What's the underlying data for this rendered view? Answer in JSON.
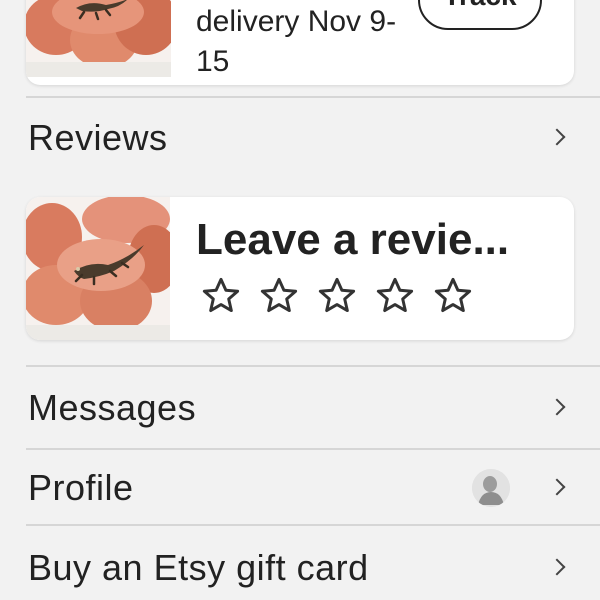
{
  "order_card": {
    "delivery_text": "delivery Nov 9-15",
    "track_label": "Track",
    "image_icon": "product-thumbnail-lizard-figurine"
  },
  "rows": {
    "reviews": "Reviews",
    "messages": "Messages",
    "profile": "Profile",
    "gift_card": "Buy an Etsy gift card"
  },
  "review_card": {
    "title": "Leave a revie...",
    "stars_total": 5,
    "rating": 0,
    "image_icon": "product-thumbnail-lizard-figurine"
  },
  "icons": {
    "chevron": "chevron-right-icon",
    "avatar": "user-avatar-placeholder",
    "star": "star-outline-icon"
  },
  "colors": {
    "background": "#f2f2f2",
    "card": "#ffffff",
    "text": "#222222",
    "divider": "#d6d6d6"
  }
}
